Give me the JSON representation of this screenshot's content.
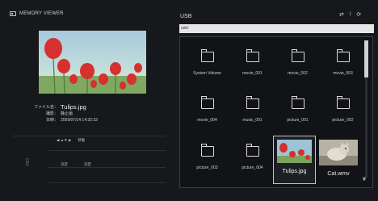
{
  "app": {
    "title": "MEMORY VIEWER"
  },
  "left_panel": {
    "file_info": {
      "file_name_label": "ファイル名：",
      "file_name": "Tulips.jpg",
      "place_label": "撮影：",
      "place": "静止画",
      "date_label": "日時：",
      "date": "2009/07/14 14:32:32"
    },
    "controls": {
      "side_label": "CB1",
      "move_icon": "◀ ▲▼ ▶",
      "move_label": "移動",
      "ok_key": "決定",
      "ok_label": "決定"
    }
  },
  "usb": {
    "title": "USB",
    "path": "usb/",
    "icons": [
      "⇄",
      "↕",
      "⟳"
    ],
    "files": [
      {
        "name": "System Volume",
        "type": "folder"
      },
      {
        "name": "movie_001",
        "type": "folder"
      },
      {
        "name": "movie_002",
        "type": "folder"
      },
      {
        "name": "movie_003",
        "type": "folder"
      },
      {
        "name": "movie_004",
        "type": "folder"
      },
      {
        "name": "music_001",
        "type": "folder"
      },
      {
        "name": "picture_001",
        "type": "folder"
      },
      {
        "name": "picture_002",
        "type": "folder"
      },
      {
        "name": "picture_003",
        "type": "folder"
      },
      {
        "name": "picture_004",
        "type": "folder"
      },
      {
        "name": "Tulips.jpg",
        "type": "image",
        "selected": true
      },
      {
        "name": "Cat.wmv",
        "type": "video"
      }
    ],
    "scroll_up": "▲",
    "scroll_down": "¥"
  }
}
